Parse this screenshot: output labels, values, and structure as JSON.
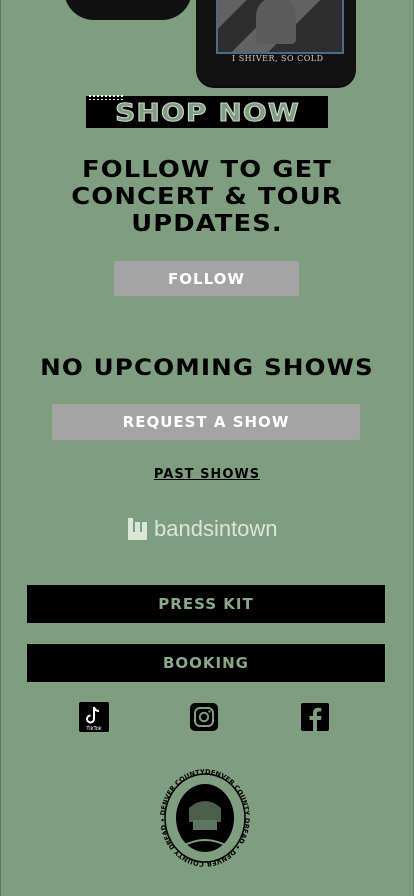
{
  "merch": {
    "caption": "I SHIVER, SO COLD"
  },
  "shop_now": {
    "label": "SHOP NOW"
  },
  "follow_section": {
    "heading_line1": "FOLLOW TO GET",
    "heading_line2": "CONCERT & TOUR",
    "heading_line3": "UPDATES.",
    "button": "FOLLOW"
  },
  "shows": {
    "status": "NO UPCOMING SHOWS",
    "request_button": "REQUEST A SHOW",
    "past_link": "PAST SHOWS"
  },
  "bandsintown": {
    "wordmark": "bandsintown"
  },
  "links": {
    "press_kit": "PRESS KIT",
    "booking": "BOOKING"
  },
  "social": {
    "tiktok_caption": "TikTok",
    "icons": [
      "tiktok-icon",
      "instagram-icon",
      "facebook-icon"
    ]
  },
  "badge": {
    "ring_text": "DENVER COUNTY DREAD • DENVER COUNTY DREAD • DENVER COUNTY DREAD •"
  },
  "colors": {
    "background": "#7f9e80",
    "button_grey": "#a4a4a4",
    "button_black": "#000000",
    "accent_text": "#8aa88b"
  }
}
